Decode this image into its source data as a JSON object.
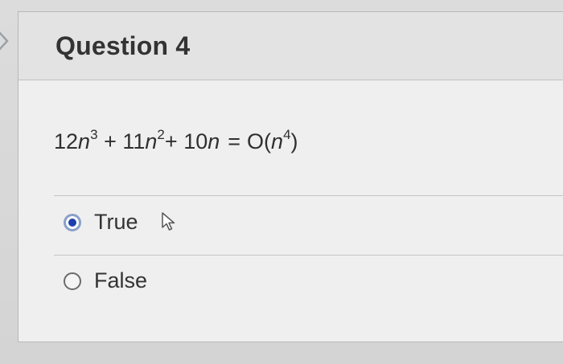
{
  "question": {
    "title": "Question 4",
    "expression": {
      "t1_coef": "12",
      "t1_var": "n",
      "t1_exp": "3",
      "plus1": "+",
      "t2_coef": "11",
      "t2_var": "n",
      "t2_exp": "2",
      "plus2": "+",
      "t3_coef": "10",
      "t3_var": "n",
      "equals": "=",
      "rhs_open": "O(",
      "rhs_var": "n",
      "rhs_exp": "4",
      "rhs_close": ")"
    }
  },
  "answers": [
    {
      "label": "True",
      "selected": true
    },
    {
      "label": "False",
      "selected": false
    }
  ],
  "colors": {
    "radio_selected": "#1d3fae",
    "header_bg": "#e3e3e3",
    "card_bg": "#efefef"
  },
  "icons": {
    "nav": "chevron-right-icon",
    "pointer": "mouse-pointer-icon"
  }
}
